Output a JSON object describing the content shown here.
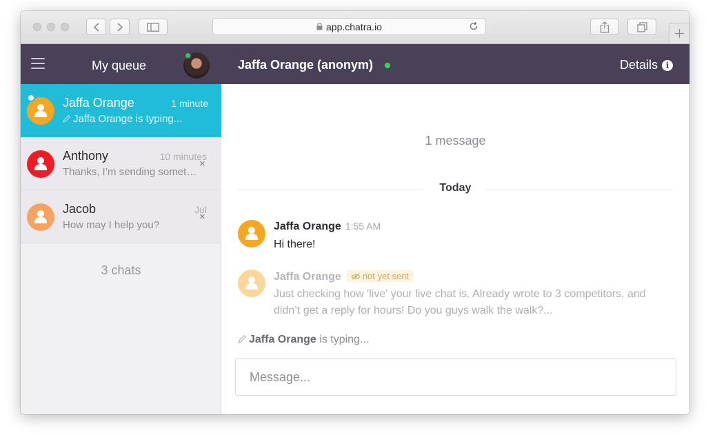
{
  "browser": {
    "url": "app.chatra.io"
  },
  "sidebar": {
    "title": "My queue",
    "chats": [
      {
        "name": "Jaffa Orange",
        "time": "1 minute",
        "preview": "Jaffa Orange is typing...",
        "avatar_color": "#f5a623",
        "active": true
      },
      {
        "name": "Anthony",
        "time": "10 minutes",
        "preview": "Thanks, I’m sending somet…",
        "avatar_color": "#ee1c25",
        "active": false,
        "close": "×"
      },
      {
        "name": "Jacob",
        "time": "Jul",
        "preview": "How may I help you?",
        "avatar_color": "#f4a460",
        "active": false,
        "close": "×"
      }
    ],
    "count_label": "3 chats"
  },
  "main": {
    "title": "Jaffa Orange (anonym)",
    "details_label": "Details",
    "message_count": "1 message",
    "day_label": "Today",
    "messages": [
      {
        "author": "Jaffa Orange",
        "time": "1:55 AM",
        "text": "Hi there!"
      },
      {
        "author": "Jaffa Orange",
        "status": "not yet sent",
        "text": "Just checking how 'live' your live chat is. Already wrote to 3 competitors, and didn’t get a reply for hours! Do you guys walk the walk?..."
      }
    ],
    "typing_name": "Jaffa Orange",
    "typing_suffix": " is typing...",
    "composer_placeholder": "Message..."
  },
  "colors": {
    "header": "#4a4158",
    "active_chat": "#21bcd7",
    "online": "#3fcf5e"
  }
}
